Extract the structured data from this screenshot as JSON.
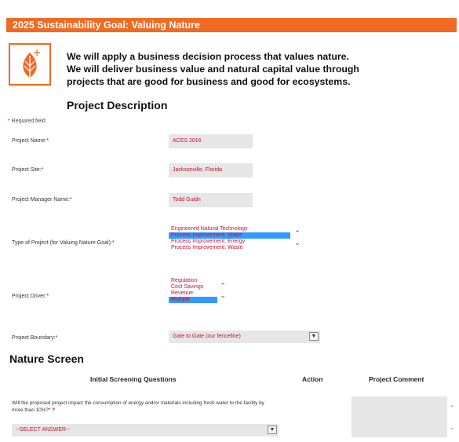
{
  "banner": {
    "title": "2025 Sustainability Goal: Valuing Nature"
  },
  "colors": {
    "accent": "#f26a21",
    "required": "#c8102e",
    "field_bg": "#e6e6e6",
    "selection": "#3399ff"
  },
  "intro": {
    "line1": "We will apply a business decision process that values nature.",
    "line2": "We will deliver business value and natural capital value through",
    "line3": "projects that are good for business and good for ecosystems."
  },
  "section_project": "Project Description",
  "required_note": {
    "star": "*",
    "text": " Required field"
  },
  "fields": {
    "project_name": {
      "label": "Project Name:*",
      "value": "ACES 2016"
    },
    "project_site": {
      "label": "Project Site:*",
      "value": "Jacksonville, Florida"
    },
    "project_manager": {
      "label": "Project Manager Name:*",
      "value": "Todd Guidn"
    },
    "project_type": {
      "label": "Type of Project (for Valuing Nature Goal):*",
      "options": [
        "Engineered Natural Technology",
        "Process Improvement: Water",
        "Process Improvement: Energy",
        "Process Improvement: Waste"
      ]
    },
    "project_driver": {
      "label": "Project Driver:*",
      "options": [
        "Regulation",
        "Cost Savings",
        "Revenue",
        "Multiple"
      ]
    },
    "project_boundary": {
      "label": "Project Boundary:*",
      "value": "Gate to Gate (our fenceline)"
    }
  },
  "section_nature": "Nature Screen",
  "table": {
    "col1": "Initial Screening Questions",
    "col2": "Action",
    "col3": "Project Comment"
  },
  "question1": {
    "text": "Will the proposed project impact the consumption of energy and/or materials including fresh water to the facility by more than 10%?*",
    "help": "?",
    "select": "--SELECT ANSWER--"
  }
}
